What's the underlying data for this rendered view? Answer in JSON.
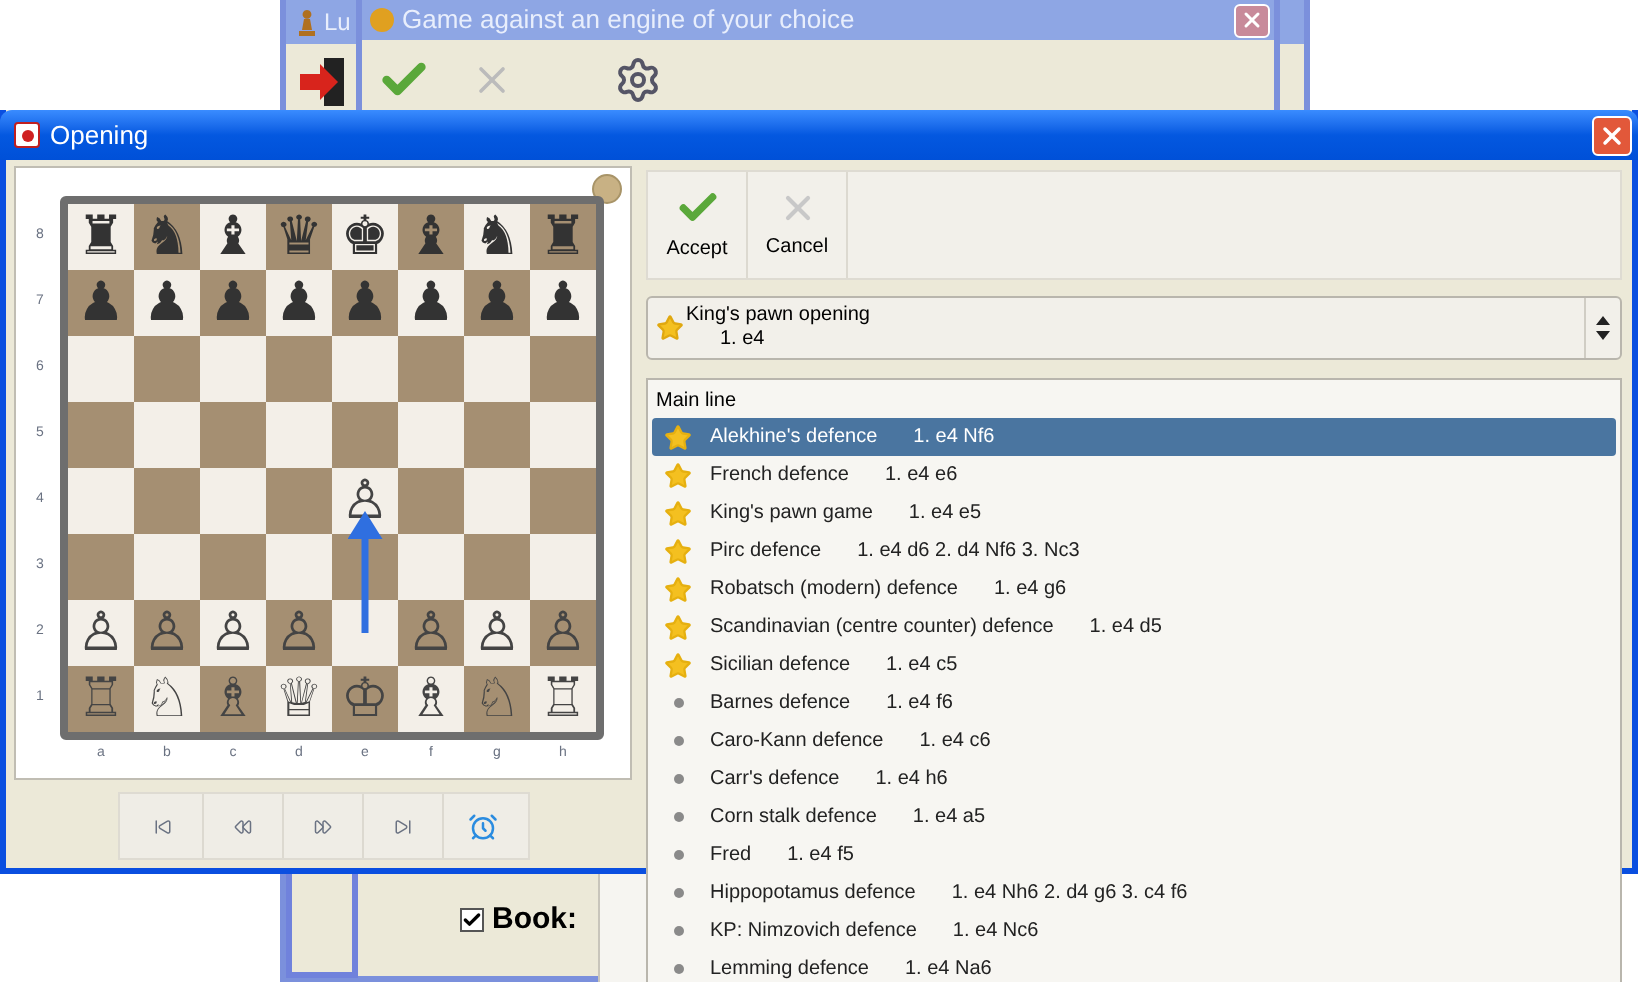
{
  "back_window": {
    "title": "Lu"
  },
  "engine_window": {
    "title": "Game against an engine of your choice"
  },
  "book": {
    "label": "Book:",
    "checked": true
  },
  "window": {
    "title": "Opening"
  },
  "board": {
    "ranks": [
      "8",
      "7",
      "6",
      "5",
      "4",
      "3",
      "2",
      "1"
    ],
    "files": [
      "a",
      "b",
      "c",
      "d",
      "e",
      "f",
      "g",
      "h"
    ],
    "squares": [
      [
        {
          "kind": "piece",
          "piece": "♜"
        },
        {
          "kind": "piece",
          "piece": "♞"
        },
        {
          "kind": "piece",
          "piece": "♝"
        },
        {
          "kind": "piece",
          "piece": "♛"
        },
        {
          "kind": "piece",
          "piece": "♚"
        },
        {
          "kind": "piece",
          "piece": "♝"
        },
        {
          "kind": "piece",
          "piece": "♞"
        },
        {
          "kind": "piece",
          "piece": "♜"
        }
      ],
      [
        {
          "kind": "piece",
          "piece": "♟"
        },
        {
          "kind": "piece",
          "piece": "♟"
        },
        {
          "kind": "piece",
          "piece": "♟"
        },
        {
          "kind": "piece",
          "piece": "♟"
        },
        {
          "kind": "piece",
          "piece": "♟"
        },
        {
          "kind": "piece",
          "piece": "♟"
        },
        {
          "kind": "piece",
          "piece": "♟"
        },
        {
          "kind": "piece",
          "piece": "♟"
        }
      ],
      [
        {
          "kind": "empty"
        },
        {
          "kind": "empty"
        },
        {
          "kind": "empty"
        },
        {
          "kind": "empty"
        },
        {
          "kind": "empty"
        },
        {
          "kind": "empty"
        },
        {
          "kind": "empty"
        },
        {
          "kind": "empty"
        }
      ],
      [
        {
          "kind": "empty"
        },
        {
          "kind": "empty"
        },
        {
          "kind": "empty"
        },
        {
          "kind": "empty"
        },
        {
          "kind": "empty"
        },
        {
          "kind": "empty"
        },
        {
          "kind": "empty"
        },
        {
          "kind": "empty"
        }
      ],
      [
        {
          "kind": "empty"
        },
        {
          "kind": "empty"
        },
        {
          "kind": "empty"
        },
        {
          "kind": "empty"
        },
        {
          "kind": "target",
          "piece": "♙"
        },
        {
          "kind": "empty"
        },
        {
          "kind": "empty"
        },
        {
          "kind": "empty"
        }
      ],
      [
        {
          "kind": "empty"
        },
        {
          "kind": "empty"
        },
        {
          "kind": "empty"
        },
        {
          "kind": "empty"
        },
        {
          "kind": "empty"
        },
        {
          "kind": "empty"
        },
        {
          "kind": "empty"
        },
        {
          "kind": "empty"
        }
      ],
      [
        {
          "kind": "piece",
          "piece": "♙"
        },
        {
          "kind": "piece",
          "piece": "♙"
        },
        {
          "kind": "piece",
          "piece": "♙"
        },
        {
          "kind": "piece",
          "piece": "♙"
        },
        {
          "kind": "origin"
        },
        {
          "kind": "piece",
          "piece": "♙"
        },
        {
          "kind": "piece",
          "piece": "♙"
        },
        {
          "kind": "piece",
          "piece": "♙"
        }
      ],
      [
        {
          "kind": "piece",
          "piece": "♖"
        },
        {
          "kind": "piece",
          "piece": "♘"
        },
        {
          "kind": "piece",
          "piece": "♗"
        },
        {
          "kind": "piece",
          "piece": "♕"
        },
        {
          "kind": "piece",
          "piece": "♔"
        },
        {
          "kind": "piece",
          "piece": "♗"
        },
        {
          "kind": "piece",
          "piece": "♘"
        },
        {
          "kind": "piece",
          "piece": "♖"
        }
      ]
    ]
  },
  "toolbar": [
    {
      "label": "Accept",
      "kind": "accept"
    },
    {
      "label": "Cancel",
      "kind": "cancel"
    }
  ],
  "opening_select": {
    "name": "King's pawn opening",
    "moves": "1. e4"
  },
  "list": {
    "header": "Main line",
    "items": [
      {
        "name": "Alekhine's defence",
        "moves": "1. e4 Nf6",
        "kind": "star",
        "selected": true
      },
      {
        "name": "French defence",
        "moves": "1. e4 e6",
        "kind": "star",
        "selected": false
      },
      {
        "name": "King's pawn game",
        "moves": "1. e4 e5",
        "kind": "star",
        "selected": false
      },
      {
        "name": "Pirc defence",
        "moves": "1. e4 d6 2. d4 Nf6 3. Nc3",
        "kind": "star",
        "selected": false
      },
      {
        "name": "Robatsch (modern) defence",
        "moves": "1. e4 g6",
        "kind": "star",
        "selected": false
      },
      {
        "name": "Scandinavian (centre counter) defence",
        "moves": "1. e4 d5",
        "kind": "star",
        "selected": false
      },
      {
        "name": "Sicilian defence",
        "moves": "1. e4 c5",
        "kind": "star",
        "selected": false
      },
      {
        "name": "Barnes defence",
        "moves": "1. e4 f6",
        "kind": "dot",
        "selected": false
      },
      {
        "name": "Caro-Kann defence",
        "moves": "1. e4 c6",
        "kind": "dot",
        "selected": false
      },
      {
        "name": "Carr's defence",
        "moves": "1. e4 h6",
        "kind": "dot",
        "selected": false
      },
      {
        "name": "Corn stalk defence",
        "moves": "1. e4 a5",
        "kind": "dot",
        "selected": false
      },
      {
        "name": "Fred",
        "moves": "1. e4 f5",
        "kind": "dot",
        "selected": false
      },
      {
        "name": "Hippopotamus defence",
        "moves": "1. e4 Nh6 2. d4 g6 3. c4 f6",
        "kind": "dot",
        "selected": false
      },
      {
        "name": "KP: Nimzovich defence",
        "moves": "1. e4 Nc6",
        "kind": "dot",
        "selected": false
      },
      {
        "name": "Lemming defence",
        "moves": "1. e4 Na6",
        "kind": "dot",
        "selected": false
      }
    ]
  }
}
